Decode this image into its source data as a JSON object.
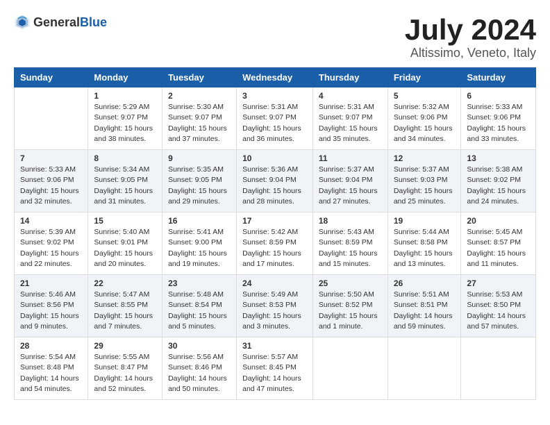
{
  "header": {
    "logo_general": "General",
    "logo_blue": "Blue",
    "title": "July 2024",
    "subtitle": "Altissimo, Veneto, Italy"
  },
  "calendar": {
    "days_of_week": [
      "Sunday",
      "Monday",
      "Tuesday",
      "Wednesday",
      "Thursday",
      "Friday",
      "Saturday"
    ],
    "weeks": [
      [
        {
          "date": "",
          "content": ""
        },
        {
          "date": "1",
          "content": "Sunrise: 5:29 AM\nSunset: 9:07 PM\nDaylight: 15 hours\nand 38 minutes."
        },
        {
          "date": "2",
          "content": "Sunrise: 5:30 AM\nSunset: 9:07 PM\nDaylight: 15 hours\nand 37 minutes."
        },
        {
          "date": "3",
          "content": "Sunrise: 5:31 AM\nSunset: 9:07 PM\nDaylight: 15 hours\nand 36 minutes."
        },
        {
          "date": "4",
          "content": "Sunrise: 5:31 AM\nSunset: 9:07 PM\nDaylight: 15 hours\nand 35 minutes."
        },
        {
          "date": "5",
          "content": "Sunrise: 5:32 AM\nSunset: 9:06 PM\nDaylight: 15 hours\nand 34 minutes."
        },
        {
          "date": "6",
          "content": "Sunrise: 5:33 AM\nSunset: 9:06 PM\nDaylight: 15 hours\nand 33 minutes."
        }
      ],
      [
        {
          "date": "7",
          "content": "Sunrise: 5:33 AM\nSunset: 9:06 PM\nDaylight: 15 hours\nand 32 minutes."
        },
        {
          "date": "8",
          "content": "Sunrise: 5:34 AM\nSunset: 9:05 PM\nDaylight: 15 hours\nand 31 minutes."
        },
        {
          "date": "9",
          "content": "Sunrise: 5:35 AM\nSunset: 9:05 PM\nDaylight: 15 hours\nand 29 minutes."
        },
        {
          "date": "10",
          "content": "Sunrise: 5:36 AM\nSunset: 9:04 PM\nDaylight: 15 hours\nand 28 minutes."
        },
        {
          "date": "11",
          "content": "Sunrise: 5:37 AM\nSunset: 9:04 PM\nDaylight: 15 hours\nand 27 minutes."
        },
        {
          "date": "12",
          "content": "Sunrise: 5:37 AM\nSunset: 9:03 PM\nDaylight: 15 hours\nand 25 minutes."
        },
        {
          "date": "13",
          "content": "Sunrise: 5:38 AM\nSunset: 9:02 PM\nDaylight: 15 hours\nand 24 minutes."
        }
      ],
      [
        {
          "date": "14",
          "content": "Sunrise: 5:39 AM\nSunset: 9:02 PM\nDaylight: 15 hours\nand 22 minutes."
        },
        {
          "date": "15",
          "content": "Sunrise: 5:40 AM\nSunset: 9:01 PM\nDaylight: 15 hours\nand 20 minutes."
        },
        {
          "date": "16",
          "content": "Sunrise: 5:41 AM\nSunset: 9:00 PM\nDaylight: 15 hours\nand 19 minutes."
        },
        {
          "date": "17",
          "content": "Sunrise: 5:42 AM\nSunset: 8:59 PM\nDaylight: 15 hours\nand 17 minutes."
        },
        {
          "date": "18",
          "content": "Sunrise: 5:43 AM\nSunset: 8:59 PM\nDaylight: 15 hours\nand 15 minutes."
        },
        {
          "date": "19",
          "content": "Sunrise: 5:44 AM\nSunset: 8:58 PM\nDaylight: 15 hours\nand 13 minutes."
        },
        {
          "date": "20",
          "content": "Sunrise: 5:45 AM\nSunset: 8:57 PM\nDaylight: 15 hours\nand 11 minutes."
        }
      ],
      [
        {
          "date": "21",
          "content": "Sunrise: 5:46 AM\nSunset: 8:56 PM\nDaylight: 15 hours\nand 9 minutes."
        },
        {
          "date": "22",
          "content": "Sunrise: 5:47 AM\nSunset: 8:55 PM\nDaylight: 15 hours\nand 7 minutes."
        },
        {
          "date": "23",
          "content": "Sunrise: 5:48 AM\nSunset: 8:54 PM\nDaylight: 15 hours\nand 5 minutes."
        },
        {
          "date": "24",
          "content": "Sunrise: 5:49 AM\nSunset: 8:53 PM\nDaylight: 15 hours\nand 3 minutes."
        },
        {
          "date": "25",
          "content": "Sunrise: 5:50 AM\nSunset: 8:52 PM\nDaylight: 15 hours\nand 1 minute."
        },
        {
          "date": "26",
          "content": "Sunrise: 5:51 AM\nSunset: 8:51 PM\nDaylight: 14 hours\nand 59 minutes."
        },
        {
          "date": "27",
          "content": "Sunrise: 5:53 AM\nSunset: 8:50 PM\nDaylight: 14 hours\nand 57 minutes."
        }
      ],
      [
        {
          "date": "28",
          "content": "Sunrise: 5:54 AM\nSunset: 8:48 PM\nDaylight: 14 hours\nand 54 minutes."
        },
        {
          "date": "29",
          "content": "Sunrise: 5:55 AM\nSunset: 8:47 PM\nDaylight: 14 hours\nand 52 minutes."
        },
        {
          "date": "30",
          "content": "Sunrise: 5:56 AM\nSunset: 8:46 PM\nDaylight: 14 hours\nand 50 minutes."
        },
        {
          "date": "31",
          "content": "Sunrise: 5:57 AM\nSunset: 8:45 PM\nDaylight: 14 hours\nand 47 minutes."
        },
        {
          "date": "",
          "content": ""
        },
        {
          "date": "",
          "content": ""
        },
        {
          "date": "",
          "content": ""
        }
      ]
    ]
  }
}
